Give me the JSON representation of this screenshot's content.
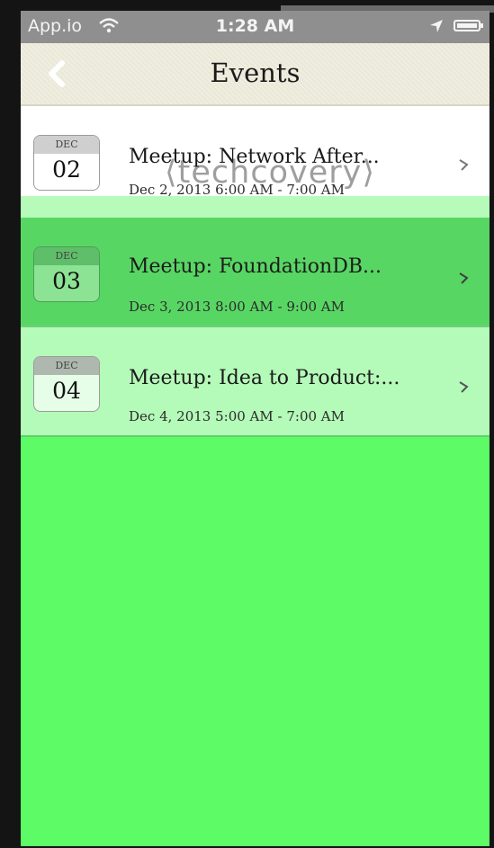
{
  "status_bar": {
    "carrier": "App.io",
    "time": "1:28 AM"
  },
  "nav": {
    "title": "Events",
    "back_icon": "chevron-left-icon"
  },
  "events": [
    {
      "month": "DEC",
      "day": "02",
      "title": "Meetup: Network After...",
      "datetime": "Dec 2, 2013   6:00 AM - 7:00 AM"
    },
    {
      "month": "DEC",
      "day": "03",
      "title": "Meetup: FoundationDB...",
      "datetime": "Dec 3, 2013   8:00 AM - 9:00 AM"
    },
    {
      "month": "DEC",
      "day": "04",
      "title": "Meetup: Idea to Product:...",
      "datetime": "Dec 4, 2013   5:00 AM - 7:00 AM"
    }
  ],
  "watermark": "techcovery",
  "colors": {
    "background_green": "#5dfc66",
    "selected_row": "#58d664",
    "light_row": "#b4fab8",
    "navbar": "#efedde"
  }
}
